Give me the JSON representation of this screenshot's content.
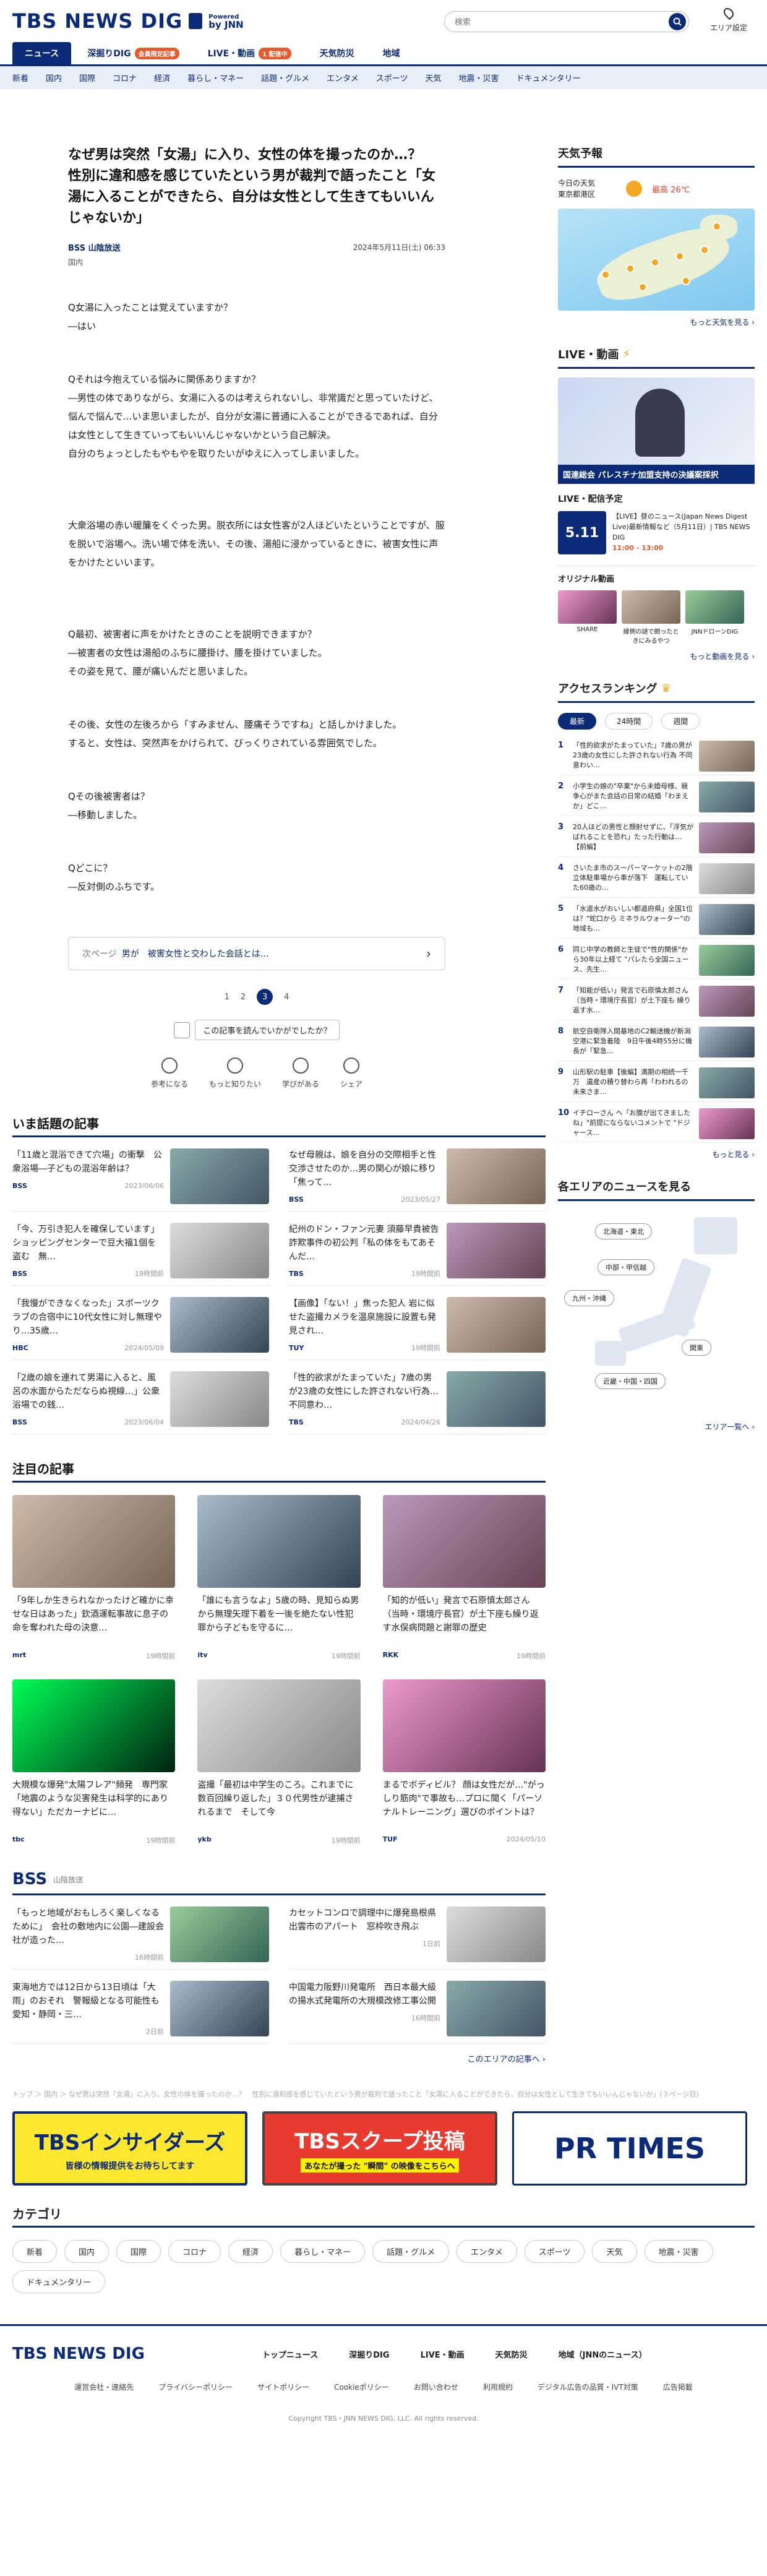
{
  "header": {
    "logo": "TBS NEWS DIG",
    "powered_line1": "Powered",
    "powered_line2": "by JNN",
    "search_placeholder": "検索",
    "region_label": "エリア設定"
  },
  "tabs": [
    {
      "label": "ニュース",
      "badge": ""
    },
    {
      "label": "深掘りDIG",
      "badge": "会員限定記事"
    },
    {
      "label": "LIVE・動画",
      "badge": "1 配信中"
    },
    {
      "label": "天気防災",
      "badge": ""
    },
    {
      "label": "地域",
      "badge": ""
    }
  ],
  "subnav": [
    "新着",
    "国内",
    "国際",
    "コロナ",
    "経済",
    "暮らし・マネー",
    "話題・グルメ",
    "エンタメ",
    "スポーツ",
    "天気",
    "地震・災害",
    "ドキュメンタリー"
  ],
  "article": {
    "title": "なぜ男は突然「女湯」に入り、女性の体を撮ったのか…？　性別に違和感を感じていたという男が裁判で語ったこと「女湯に入ることができたら、自分は女性として生きてもいいんじゃないか」",
    "source": "BSS 山陰放送",
    "date": "2024年5月11日(土) 06:33",
    "category": "国内",
    "paragraphs": [
      "Q女湯に入ったことは覚えていますか？\n―はい",
      "Qそれは今抱えている悩みに関係ありますか？\n―男性の体でありながら、女湯に入るのは考えられないし、非常識だと思っていたけど、悩んで悩んで…いま思いましたが、自分が女湯に普通に入ることができるであれば、自分は女性として生きていってもいいんじゃないかという自己解決。\n自分のちょっとしたもやもやを取りたいがゆえに入ってしまいました。",
      "大衆浴場の赤い暖簾をくぐった男。脱衣所には女性客が2人ほどいたということですが、服を脱いで浴場へ。洗い場で体を洗い、その後、湯船に浸かっているときに、被害女性に声をかけたといいます。",
      "Q最初、被害者に声をかけたときのことを説明できますか？\n―被害者の女性は湯船のふちに腰掛け、腰を掛けていました。\nその姿を見て、腰が痛いんだと思いました。",
      "その後、女性の左後ろから「すみません、腰痛そうですね」と話しかけました。\nすると、女性は、突然声をかけられて、びっくりされている雰囲気でした。",
      "Qその後被害者は？\n―移動しました。",
      "Qどこに？\n―反対側のふちです。"
    ],
    "next_label": "次ページ",
    "next_title": "男が　被害女性と交わした会話とは…",
    "pages": [
      "1",
      "2",
      "3",
      "4"
    ],
    "current_page": "3",
    "feedback_question": "この記事を読んでいかがでしたか？",
    "reactions": [
      "参考になる",
      "もっと知りたい",
      "学びがある",
      "シェア"
    ]
  },
  "hot": {
    "title": "いま話題の記事",
    "items": [
      {
        "text": "「11歳と混浴できて穴場」の衝撃　公衆浴場―子どもの混浴年齢は？",
        "src": "BSS",
        "date": "2023/06/06"
      },
      {
        "text": "なぜ母親は、娘を自分の交際相手と性交渉させたのか…男の関心が娘に移り「焦って…",
        "src": "BSS",
        "date": "2023/05/27"
      },
      {
        "text": "「今、万引き犯人を確保しています」ショッピングセンターで豆大福1個を盗む　無…",
        "src": "BSS",
        "date": "19時間前"
      },
      {
        "text": "紀州のドン・ファン元妻 須藤早貴被告　詐欺事件の初公判「私の体をもてあそんだ…",
        "src": "TBS",
        "date": "19時間前"
      },
      {
        "text": "「我慢ができなくなった」スポーツクラブの合宿中に10代女性に対し無理やり…35歳…",
        "src": "HBC",
        "date": "2024/05/09"
      },
      {
        "text": "【画像】「ない！」焦った犯人 岩に似せた盗撮カメラを温泉施設に設置も発見され…",
        "src": "TUY",
        "date": "19時間前"
      },
      {
        "text": "「2歳の娘を連れて男湯に入ると、風呂の水面からただならぬ視線…」公衆浴場での銭…",
        "src": "BSS",
        "date": "2023/06/04"
      },
      {
        "text": "「性的欲求がたまっていた」7歳の男が23歳の女性にした許されない行為…不同意わ…",
        "src": "TBS",
        "date": "2024/04/26"
      }
    ]
  },
  "featured": {
    "title": "注目の記事",
    "items": [
      {
        "text": "「9年しか生きられなかったけど確かに幸せな日はあった」欽酒運転事故に息子の命を奪われた母の決意…",
        "src": "mrt",
        "date": "19時間前"
      },
      {
        "text": "「誰にも言うなよ」5歳の時、見知らぬ男から無理矢理下着を一後を絶たない性犯罪から子どもを守るに…",
        "src": "itv",
        "date": "19時間前"
      },
      {
        "text": "「知的が低い」発言で石原慎太郎さん（当時・環境庁長官）が土下座も繰り返す水俣病問題と謝罪の歴史",
        "src": "RKK",
        "date": "19時間前"
      },
      {
        "text": "大規模な爆発\"太陽フレア\"頻発　専門家「地震のような災害発生は科学的にあり得ない」ただカーナビに…",
        "src": "tbc",
        "date": "19時間前"
      },
      {
        "text": "盗撮「最初は中学生のころ。これまでに数百回繰り返した」３０代男性が逮捕されるまで　そして今",
        "src": "ykb",
        "date": "19時間前"
      },
      {
        "text": "まるでボディビル？ 顔は女性だが…\"がっしり筋肉\"で事故も…プロに聞く「パーソナルトレーニング」選びのポイントは？",
        "src": "TUF",
        "date": "2024/05/10"
      }
    ]
  },
  "local": {
    "logo": "BSS",
    "name": "山陰放送",
    "items": [
      {
        "text": "「もっと地域がおもしろく楽しくなるために」　会社の敷地内に公園―建設会社が造った…",
        "date": "16時間前"
      },
      {
        "text": "カセットコンロで調理中に爆発島根県出雲市のアパート　窓枠吹き飛ぶ",
        "date": "1日前"
      },
      {
        "text": "東海地方では12日から13日頃は「大雨」のおそれ　警報級となる可能性も　愛知・静岡・三…",
        "date": "2日前"
      },
      {
        "text": "中国電力阪野川発電所　西日本最大級の揚水式発電所の大規模改修工事公開",
        "date": "16時間前"
      }
    ],
    "more": "このエリアの記事へ ›"
  },
  "breadcrumb": "トップ ＞ 国内 ＞ なぜ男は突然「女湯」に入り、女性の体を撮ったのか…？　性別に違和感を感じていたという男が裁判で語ったこと「女湯に入ることができたら、自分は女性として生きてもいいんじゃないか」(３ページ目)",
  "banners": {
    "insiders": "TBSインサイダーズ",
    "insiders_sub": "皆様の情報提供をお待ちしてます",
    "scoop": "TBSスクープ投稿",
    "scoop_sub": "あなたが撮った \"瞬間\" の映像をこちらへ",
    "prtimes": "PR TIMES"
  },
  "categories": {
    "title": "カテゴリ",
    "chips": [
      "新着",
      "国内",
      "国際",
      "コロナ",
      "経済",
      "暮らし・マネー",
      "話題・グルメ",
      "エンタメ",
      "スポーツ",
      "天気",
      "地震・災害",
      "ドキュメンタリー"
    ]
  },
  "footer": {
    "logo": "TBS NEWS DIG",
    "links": [
      "トップニュース",
      "深掘りDIG",
      "LIVE・動画",
      "天気防災",
      "地域（JNNのニュース）"
    ],
    "sublinks": [
      "運営会社・連絡先",
      "プライバシーポリシー",
      "サイトポリシー",
      "Cookieポリシー",
      "お問い合わせ",
      "利用規約",
      "デジタル広告の品質・IVT対策",
      "広告掲載"
    ],
    "copyright": "Copyright TBS・JNN NEWS DIG, LLC. All rights reserved."
  },
  "sidebar": {
    "weather_title": "天気予報",
    "weather_loc1": "今日の天気",
    "weather_loc2": "東京都港区",
    "weather_hi": "最高 26℃",
    "weather_lo": "",
    "weather_more": "もっと天気を見る ›",
    "live_title": "LIVE・動画",
    "live_caption": "国連総会 パレスチナ加盟支持の決議案採択",
    "live_plan": "LIVE・配信予定",
    "live_date": "5.11",
    "live_text": "【LIVE】昼のニュース(Japan News Digest Live)最新情報など（5月11日）| TBS NEWS DIG",
    "live_time": "11:00 - 13:00",
    "orig_title": "オリジナル動画",
    "orig": [
      "SHARE",
      "縁側の謎で朗ったときにみるやつ",
      "JNNドローンDIG"
    ],
    "video_more": "もっと動画を見る ›",
    "rank_title": "アクセスランキング",
    "rank_tabs": [
      "最新",
      "24時間",
      "週間"
    ],
    "ranks": [
      "「性的欲求がたまっていた」7歳の男が23歳の女性にした許されない行為 不同意わい…",
      "小学生の娘の\"卒業\"から未婚母様、競争心がまた会話の日常の結婚「わまえか」どこ…",
      "20人ほどの男性と顔射せずに、「浮気がばれることを恐れ」たった行動は…【前編】",
      "さいたま市のスーパーマーケットの2階立体駐車場から車が落下　運転していた60歳の…",
      "「水道水がおいしい都道府県」全国1位は？\"蛇口から ミネラルウォーター\"の地域も…",
      "同じ中学の教師と生徒で\"性的関係\"から30年以上経て \"パレたら全国ニュース、先生…",
      "「知能が低い」発言で石原慎太郎さん（当時・環境庁長官）が土下座も 繰り返す水…",
      "航空自衛隊入間基地のC2輸送機が新潟空港に緊急着陸　9日午後4時55分に機長が「緊急…",
      "山形駅の駐車【後編】満期の相続一千万　遺産の積り替わら再「わわれるの未来さま…",
      "イチローさん へ「お腹が出てきましたね」\"前提にならないコメントで \"ドジャース…"
    ],
    "rank_more": "もっと見る ›",
    "area_title": "各エリアのニュースを見る",
    "areas": [
      "北海道・東北",
      "中部・甲信越",
      "九州・沖縄",
      "関東",
      "近畿・中国・四国"
    ],
    "area_more": "エリア一覧へ ›"
  }
}
